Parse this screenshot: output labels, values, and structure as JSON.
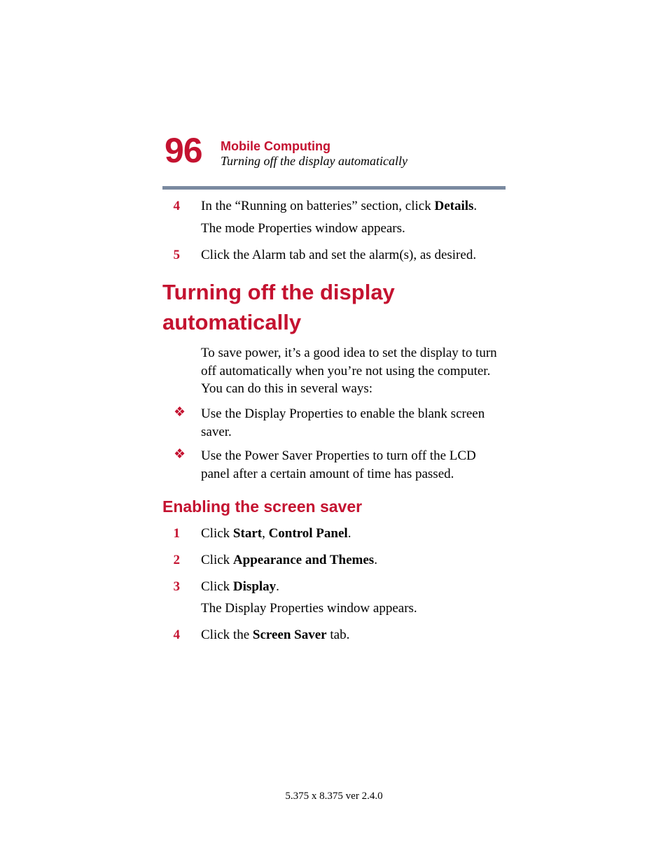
{
  "header": {
    "page_number": "96",
    "chapter": "Mobile Computing",
    "subtitle": "Turning off the display automatically"
  },
  "pre_list": {
    "items": [
      {
        "num": "4",
        "html": "In the “Running on batteries” section, click <b>Details</b>.",
        "after": "The mode Properties window appears."
      },
      {
        "num": "5",
        "html": "Click the Alarm tab and set the alarm(s), as desired."
      }
    ]
  },
  "heading1": "Turning off the display automatically",
  "intro_para": "To save power, it’s a good idea to set the display to turn off automatically when you’re not using the computer. You can do this in several ways:",
  "bullets": [
    "Use the Display Properties to enable the blank screen saver.",
    "Use the Power Saver Properties to turn off the LCD panel after a certain amount of time has passed."
  ],
  "heading2": "Enabling the screen saver",
  "steps": [
    {
      "num": "1",
      "html": "Click <b>Start</b>, <b>Control Panel</b>."
    },
    {
      "num": "2",
      "html": "Click <b>Appearance and Themes</b>."
    },
    {
      "num": "3",
      "html": "Click <b>Display</b>.",
      "after": "The Display Properties window appears."
    },
    {
      "num": "4",
      "html": "Click the <b>Screen Saver</b> tab."
    }
  ],
  "footer": "5.375 x 8.375 ver 2.4.0",
  "bullet_glyph": "❖"
}
